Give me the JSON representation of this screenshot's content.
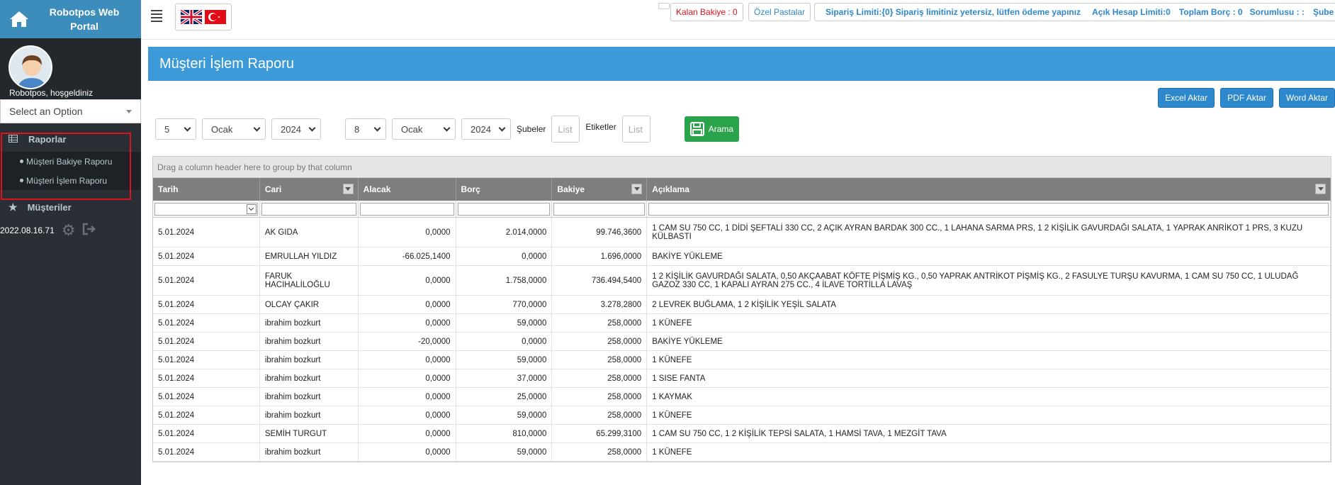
{
  "brand": {
    "title": "Robotpos Web Portal"
  },
  "profile": {
    "welcome": "Robotpos, hoşgeldiniz"
  },
  "sidebar": {
    "select_placeholder": "Select an Option",
    "raporlar": "Raporlar",
    "sub_items": [
      "Müşteri Bakiye Raporu",
      "Müşteri İşlem Raporu"
    ],
    "musteriler": "Müşteriler",
    "version": "2022.08.16.71"
  },
  "topbar": {
    "kalan_bakiye": "Kalan Bakiye : 0",
    "ozel_pastalar": "Özel Pastalar",
    "siparis_limiti": "Sipariş Limiti:{0} Sipariş limitiniz yetersiz, lütfen ödeme yapınız",
    "acik_hesap": "Açık Hesap Limiti:0",
    "toplam_borc": "Toplam Borç : 0",
    "sorumlusu": "Sorumlusu : :",
    "sube": "Şube"
  },
  "page": {
    "title": "Müşteri İşlem Raporu"
  },
  "exports": {
    "excel": "Excel Aktar",
    "pdf": "PDF Aktar",
    "word": "Word Aktar"
  },
  "filters": {
    "start_day": "5",
    "start_month": "Ocak",
    "start_year": "2024",
    "end_day": "8",
    "end_month": "Ocak",
    "end_year": "2024",
    "subeler_label": "Şubeler",
    "subeler_placeholder": "List",
    "etiketler_label": "Etiketler",
    "etiketler_placeholder": "List",
    "search_label": "Arama"
  },
  "grid": {
    "group_hint": "Drag a column header here to group by that column",
    "columns": [
      "Tarih",
      "Cari",
      "Alacak",
      "Borç",
      "Bakiye",
      "Açıklama"
    ],
    "rows": [
      [
        "5.01.2024",
        "AK GIDA",
        "0,0000",
        "2.014,0000",
        "99.746,3600",
        "1 CAM SU 750 CC, 1 DİDİ ŞEFTALİ 330 CC, 2 AÇIK AYRAN BARDAK 300 CC., 1 LAHANA SARMA PRS, 1 2 KİŞİLİK GAVURDAĞI SALATA, 1 YAPRAK ANRİKOT 1 PRS, 3 KUZU KÜLBASTI"
      ],
      [
        "5.01.2024",
        "EMRULLAH YILDIZ",
        "-66.025,1400",
        "0,0000",
        "1.696,0000",
        "BAKİYE YÜKLEME"
      ],
      [
        "5.01.2024",
        "FARUK HACIHALİLOĞLU",
        "0,0000",
        "1.758,0000",
        "736.494,5400",
        "1 2 KİŞİLİK GAVURDAĞI SALATA, 0,50 AKÇAABAT KÖFTE PİŞMİŞ KG., 0,50 YAPRAK ANTRİKOT PİŞMİŞ KG., 2 FASULYE TURŞU KAVURMA, 1 CAM SU 750 CC, 1 ULUDAĞ GAZOZ 330 CC, 1 KAPALI AYRAN 275 CC., 4 İLAVE TORTİLLA LAVAŞ"
      ],
      [
        "5.01.2024",
        "OLCAY ÇAKIR",
        "0,0000",
        "770,0000",
        "3.278,2800",
        "2 LEVREK BUĞLAMA, 1 2 KİŞİLİK YEŞİL SALATA"
      ],
      [
        "5.01.2024",
        "ibrahim bozkurt",
        "0,0000",
        "59,0000",
        "258,0000",
        "1 KÜNEFE"
      ],
      [
        "5.01.2024",
        "ibrahim bozkurt",
        "-20,0000",
        "0,0000",
        "258,0000",
        "BAKİYE YÜKLEME"
      ],
      [
        "5.01.2024",
        "ibrahim bozkurt",
        "0,0000",
        "59,0000",
        "258,0000",
        "1 KÜNEFE"
      ],
      [
        "5.01.2024",
        "ibrahim bozkurt",
        "0,0000",
        "37,0000",
        "258,0000",
        "1 SISE FANTA"
      ],
      [
        "5.01.2024",
        "ibrahim bozkurt",
        "0,0000",
        "25,0000",
        "258,0000",
        "1 KAYMAK"
      ],
      [
        "5.01.2024",
        "ibrahim bozkurt",
        "0,0000",
        "59,0000",
        "258,0000",
        "1 KÜNEFE"
      ],
      [
        "5.01.2024",
        "SEMİH TURGUT",
        "0,0000",
        "810,0000",
        "65.299,3100",
        "1 CAM SU 750 CC, 1 2 KİŞİLİK TEPSİ SALATA, 1 HAMSİ TAVA, 1 MEZGİT TAVA"
      ],
      [
        "5.01.2024",
        "ibrahim bozkurt",
        "0,0000",
        "59,0000",
        "258,0000",
        "1 KÜNEFE"
      ]
    ]
  }
}
